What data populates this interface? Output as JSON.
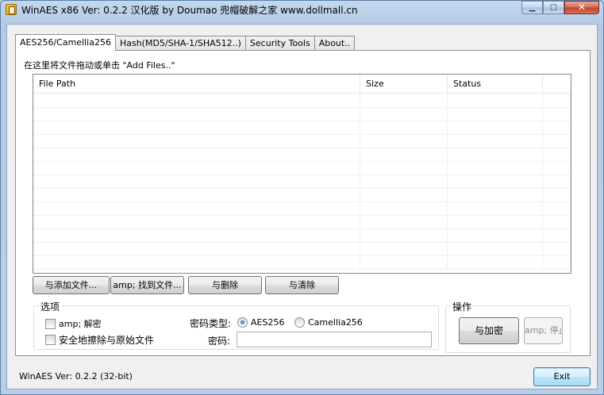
{
  "window": {
    "title": "WinAES x86 Ver: 0.2.2 汉化版 by Doumao 兜帽破解之家 www.dollmall.cn"
  },
  "tabs": [
    {
      "label": "AES256/Camellia256",
      "active": true
    },
    {
      "label": "Hash(MD5/SHA-1/SHA512..)",
      "active": false
    },
    {
      "label": "Security Tools",
      "active": false
    },
    {
      "label": "About..",
      "active": false
    }
  ],
  "drop_hint": "在这里将文件拖动或单击 \"Add Files..\"",
  "file_list": {
    "columns": [
      "File Path",
      "Size",
      "Status",
      ""
    ],
    "rows": []
  },
  "buttons": {
    "add_files": "与添加文件...",
    "find_files": "amp; 找到文件...",
    "delete": "与删除",
    "clear": "与清除",
    "encrypt": "与加密",
    "stop": "amp; 停止",
    "exit": "Exit"
  },
  "options": {
    "group_label": "选项",
    "decrypt_label": "amp; 解密",
    "decrypt_checked": false,
    "secure_wipe_label": "安全地擦除与原始文件",
    "secure_wipe_checked": false,
    "cipher_label": "密码类型:",
    "cipher_aes": "AES256",
    "cipher_camellia": "Camellia256",
    "cipher_selected": "AES256",
    "password_label": "密码:",
    "password_value": ""
  },
  "actions": {
    "group_label": "操作"
  },
  "status_line": "WinAES Ver: 0.2.2 (32-bit)",
  "colors": {
    "frame": "#b9cfe8",
    "panel": "#ffffff",
    "close_button": "#c23f27"
  }
}
